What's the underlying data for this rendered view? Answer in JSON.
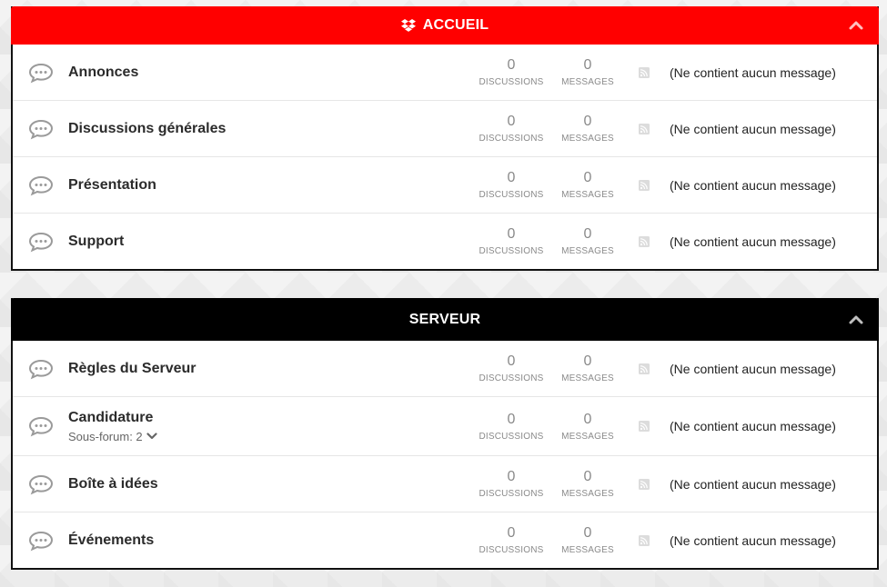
{
  "colors": {
    "accueil_header": "#ff0000",
    "serveur_header": "#000000",
    "header_text": "#ffffff"
  },
  "categories": [
    {
      "title": "ACCUEIL",
      "icon": "dropbox-icon",
      "forums": [
        {
          "title": "Annonces",
          "discussions": "0",
          "messages": "0",
          "last": "(Ne contient aucun message)"
        },
        {
          "title": "Discussions générales",
          "discussions": "0",
          "messages": "0",
          "last": "(Ne contient aucun message)"
        },
        {
          "title": "Présentation",
          "discussions": "0",
          "messages": "0",
          "last": "(Ne contient aucun message)"
        },
        {
          "title": "Support",
          "discussions": "0",
          "messages": "0",
          "last": "(Ne contient aucun message)"
        }
      ]
    },
    {
      "title": "SERVEUR",
      "forums": [
        {
          "title": "Règles du Serveur",
          "discussions": "0",
          "messages": "0",
          "last": "(Ne contient aucun message)"
        },
        {
          "title": "Candidature",
          "subforums": "Sous-forum: 2",
          "discussions": "0",
          "messages": "0",
          "last": "(Ne contient aucun message)"
        },
        {
          "title": "Boîte à idées",
          "discussions": "0",
          "messages": "0",
          "last": "(Ne contient aucun message)"
        },
        {
          "title": "Événements",
          "discussions": "0",
          "messages": "0",
          "last": "(Ne contient aucun message)"
        }
      ]
    }
  ],
  "labels": {
    "discussions": "DISCUSSIONS",
    "messages": "MESSAGES"
  }
}
